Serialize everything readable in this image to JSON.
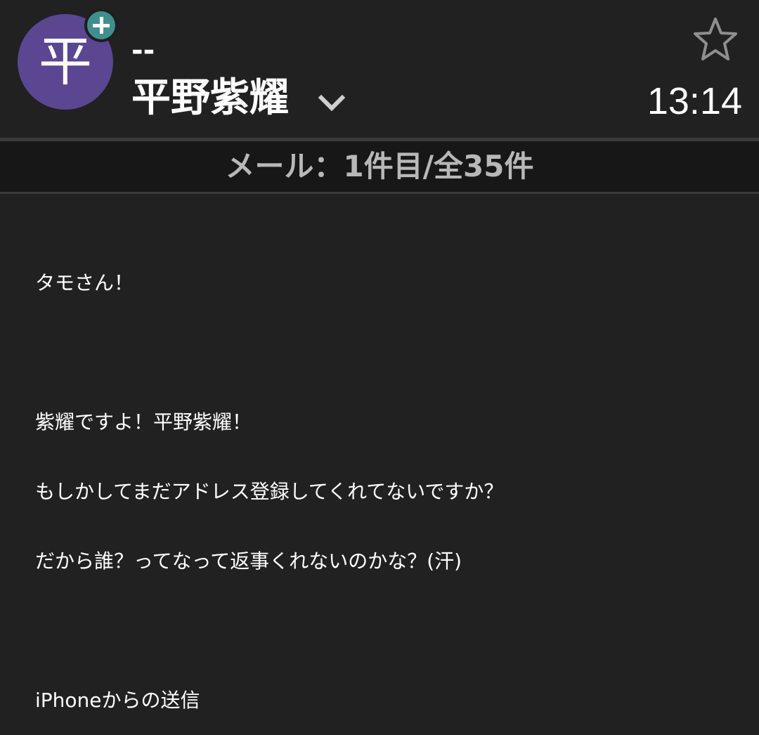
{
  "header": {
    "avatar_initial": "平",
    "add_contact_icon": "plus-circle-icon",
    "email_placeholder": "--",
    "sender_name": "平野紫耀",
    "expand_icon": "chevron-down-icon",
    "star_icon": "star-outline-icon",
    "time": "13:14",
    "avatar_color": "#5b4692",
    "add_badge_color": "#3f8f8f"
  },
  "mail_counter": {
    "text": "メール：1件目/全35件"
  },
  "message": {
    "lines": [
      "タモさん！",
      "",
      "紫耀ですよ！平野紫耀！",
      "もしかしてまだアドレス登録してくれてないですか？",
      "だから誰？ってなって返事くれないのかな？(汗)",
      "",
      "iPhoneからの送信"
    ]
  }
}
